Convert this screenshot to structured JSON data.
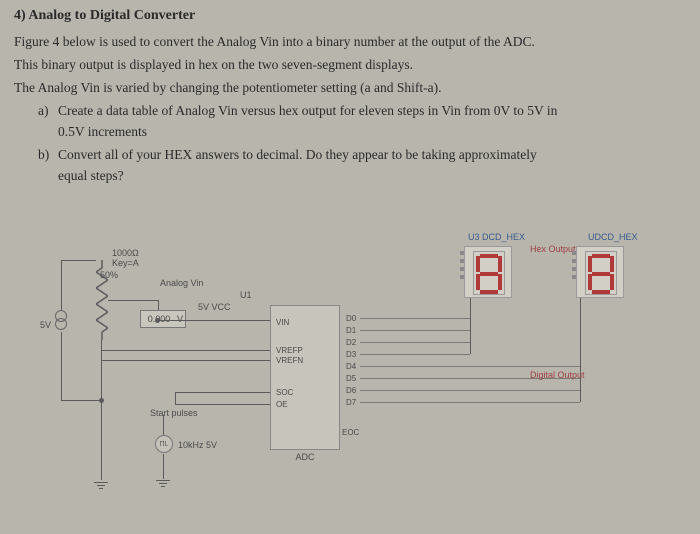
{
  "heading": "4)  Analog to Digital Converter",
  "para1": "Figure 4 below is used to convert the Analog Vin into a binary number at the output of the ADC.",
  "para2": "This binary output is displayed in hex on the two seven-segment displays.",
  "para3": "The Analog Vin is varied by changing the potentiometer setting (a and Shift-a).",
  "item_a_label": "a)",
  "item_a_text1": "Create a data table of Analog Vin versus hex output for eleven steps in Vin from 0V to 5V in",
  "item_a_text2": "0.5V increments",
  "item_b_label": "b)",
  "item_b_text1": "Convert all of your HEX answers to decimal. Do they appear to be taking approximately",
  "item_b_text2": "equal steps?",
  "circuit": {
    "pot_value": "1000Ω",
    "pot_key": "Key=A",
    "pot_pct": "50%",
    "analog_label": "Analog Vin",
    "volt_reading": "0.000",
    "volt_unit": "V",
    "source": "5V",
    "u1": "U1",
    "vcc5v": "5V   VCC",
    "pins": {
      "vin": "VIN",
      "vrefp": "VREFP",
      "vrefn": "VREFN",
      "soc": "SOC",
      "oe": "OE",
      "d0": "D0",
      "d1": "D1",
      "d2": "D2",
      "d3": "D3",
      "d4": "D4",
      "d5": "D5",
      "d6": "D6",
      "d7": "D7",
      "eoc": "EOC"
    },
    "adc_name": "ADC",
    "start_pulses": "Start pulses",
    "clock_src": "10kHz  5V",
    "clock_sym": "ΠL",
    "disp_left_title": "U3 DCD_HEX",
    "disp_right_title": "UDCD_HEX",
    "hex_output": "Hex Output",
    "digital_output": "Digital Output"
  }
}
